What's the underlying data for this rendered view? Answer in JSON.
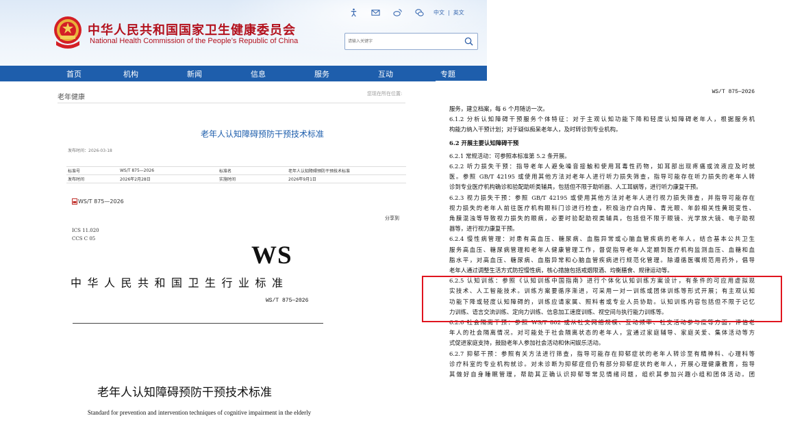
{
  "site": {
    "title_cn": "中华人民共和国国家卫生健康委员会",
    "title_en": "National Health Commission of the People’s Republic of China",
    "top_icons": [
      "accessibility-icon",
      "mail-icon",
      "weibo-icon",
      "wechat-icon"
    ],
    "lang": {
      "zh": "中文",
      "sep": "|",
      "en": "英文"
    },
    "search": {
      "placeholder": "请输入关键字"
    },
    "nav": [
      "首页",
      "机构",
      "新闻",
      "信息",
      "服务",
      "互动",
      "专题"
    ],
    "colors": {
      "brand_red": "#b3111d",
      "nav_blue": "#1e5eac",
      "highlight": "#e0141e"
    }
  },
  "article": {
    "crumb": "老年健康",
    "location_label": "您现在所在位置:",
    "title": "老年人认知障碍预防干预技术标准",
    "pub_date": "发布时间：2026-03-18",
    "meta": [
      [
        "标准号",
        "WS/T 875—2026",
        "标准名",
        "老年人认知障碍预防干预技术标准"
      ],
      [
        "发布时间",
        "2026年2月28日",
        "实施时间",
        "2026年9月1日"
      ]
    ],
    "attachment": "WS/T 875—2026",
    "share": "分享到"
  },
  "cover": {
    "ics": "ICS  11.020",
    "ccs": "CCS  C 05",
    "logo": "WS",
    "std_name": "中华人民共和国卫生行业标准",
    "code": "WS/T 875—2026",
    "title_cn": "老年人认知障碍预防干预技术标准",
    "title_en": "Standard for prevention and intervention techniques of cognitive impairment in the elderly"
  },
  "page": {
    "header": "WS/T 875—2026",
    "lines": [
      {
        "t": "服务，建立档案，每 6 个月随访一次。",
        "last": true
      },
      {
        "t": "6.1.2  分析认知障碍干预服务个体特征：对于主观认知功能下降和轻度认知障碍老年人，根据服务机"
      },
      {
        "t": "构能力纳入干预计划；对于疑似痴呆老年人，及时转诊到专业机构。",
        "last": true
      },
      {
        "t": "6.2  开展主要认知障碍干预",
        "head": true
      },
      {
        "t": "6.2.1  常规活动：可参照本标准第 5.2 条开展。",
        "last": true
      },
      {
        "t": "6.2.2  听力损失干预：指导老年人避免噪音接触和使用耳毒性药物，如耳部出现疼痛或流液应及时就"
      },
      {
        "t": "医。参照 GB/T 42195 或使用其他方法对老年人进行听力损失筛查，指导可能存在听力损失的老年人转"
      },
      {
        "t": "诊到专业医疗机构确诊和验配助听类辅具，包括但不限于助听器、人工耳蜗等，进行听力康复干预。",
        "last": true
      },
      {
        "t": "6.2.3  视力损失干预：参照 GB/T 42195 或使用其他方法对老年人进行视力损失筛查，并指导可能存在"
      },
      {
        "t": "视力损失的老年人前往医疗机构眼科门诊进行检查，积极治疗白内障、青光眼、年龄相关性黄斑变性、"
      },
      {
        "t": "角膜混浊等导致视力损失的眼病，必要时验配助视类辅具，包括但不限于眼镜、光学放大镜、电子助视"
      },
      {
        "t": "器等，进行视力康复干预。",
        "last": true
      },
      {
        "t": "6.2.4  慢性病管理：对患有高血压、糖尿病、血脂异常或心脑血管疾病的老年人，结合基本公共卫生"
      },
      {
        "t": "服务高血压、糖尿病管理和老年人健康管理工作，督促指导老年人定期到医疗机构监测血压、血糖和血"
      },
      {
        "t": "脂水平，对高血压、糖尿病、血脂异常和心脑血管疾病进行规范化管理。除遵循医嘱规范用药外，倡导"
      },
      {
        "t": "老年人通过调整生活方式防控慢性病，核心措施包括戒烟限酒、均衡膳食、规律运动等。",
        "last": true
      },
      {
        "t": "6.2.5  认知训练：参照《认知训练中国指南》进行个体化认知训练方案设计，有条件的可应用虚拟现"
      },
      {
        "t": "实技术、人工智能技术。训练方案要循序渐进，可采用一对一训练或团体训练等形式开展；有主观认知"
      },
      {
        "t": "功能下降或轻度认知障碍的，训练应请家属、照料者或专业人员协助。认知训练内容包括但不限于记忆"
      },
      {
        "t": "力训练、语言交流训练、定向力训练、信息加工速度训练、视空间与执行能力训练等。",
        "last": true
      },
      {
        "t": "6.2.6  社会隔离干预：参照 WS/T 802 或从社交网络规模、互动频率、社交活动参与度等方面，评估老"
      },
      {
        "t": "年人的社会隔离情况。对可能处于社会隔离状态的老年人，宜通过家庭辅导、家庭关爱、集体活动等方"
      },
      {
        "t": "式促进家庭支持，鼓励老年人参加社会活动和休闲娱乐活动。",
        "last": true
      },
      {
        "t": "6.2.7  抑郁干预：参照有关方法进行筛查，指导可能存在抑郁症状的老年人转诊至有精神科、心理科等"
      },
      {
        "t": "诊疗科室的专业机构就诊。对未诊断为抑郁症但仍有部分抑郁症状的老年人，开展心理健康教育，指导"
      },
      {
        "t": "其做好自身睡眠管理，帮助其正确认识抑郁等常见情绪问题，组织其参加兴趣小组和团体活动。团"
      }
    ]
  }
}
